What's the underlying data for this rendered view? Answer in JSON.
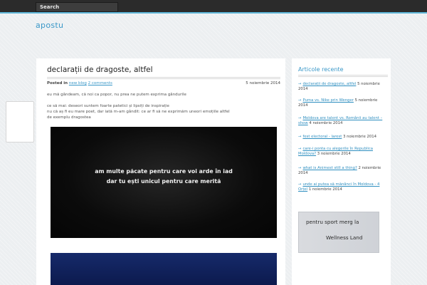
{
  "header": {
    "search_placeholder": "Search"
  },
  "site": {
    "title": "apostu"
  },
  "post": {
    "title": "declarații de dragoste, altfel",
    "posted_in_label": "Posted in",
    "category_link": "new blog",
    "comments_link": "2 comments",
    "date": "5 noiembrie 2014",
    "paragraph1": "eu mă gândeam, că noi ca popor, nu prea ne putem exprima gândurile",
    "paragraph2": [
      "ce să mai: deseori suntem foarte patetici și lipsiți de inspirație",
      "nu că aș fi eu mare poet, dar iată m-am gândit: ce ar fi să ne exprimăm uneori emoțiile altfel",
      "de exemplu dragostea"
    ],
    "image_text": [
      "am multe păcate pentru care voi arde în iad",
      "dar tu ești unicul pentru care merită"
    ]
  },
  "sidebar": {
    "title": "Articole recente",
    "items": [
      {
        "link": "declarații de dragoste, altfel",
        "date": "5 noiembrie 2014"
      },
      {
        "link": "Puma vs. Nike prin Wenger",
        "date": "5 noiembrie 2014"
      },
      {
        "link": "Moldova are talent vs. Românii au talent – show",
        "date": "4 noiembrie 2014"
      },
      {
        "link": "fest electoral - larest",
        "date": "3 noiembrie 2014"
      },
      {
        "link": "care-i ponta cu alegerile în Republica Moldova?",
        "date": "3 noiembrie 2014"
      },
      {
        "link": "what is Animest still a thing?",
        "date": "2 noiembrie 2014"
      },
      {
        "link": "unde ai putea să mănânci în Moldova - 4 Orțel",
        "date": "1 noiembrie 2014"
      }
    ],
    "ad": {
      "line1": "pentru sport merg la",
      "line2": "Wellness Land"
    }
  }
}
